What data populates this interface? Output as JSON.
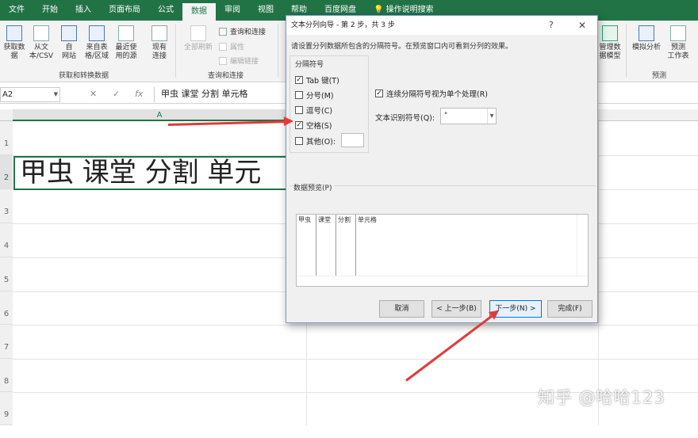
{
  "ribbon_tabs": [
    "文件",
    "开始",
    "插入",
    "页面布局",
    "公式",
    "数据",
    "审阅",
    "视图",
    "帮助",
    "百度网盘",
    "操作说明搜索"
  ],
  "ribbon": {
    "get_data": "获取数\n据",
    "from_text": "从文\n本/CSV",
    "from_web": "自\n网站",
    "from_table": "来自表\n格/区域",
    "recent_sources": "最近使\n用的源",
    "existing": "现有\n连接",
    "refresh_all": "全部刷新",
    "queries_connections": "查询和连接",
    "properties": "属性",
    "edit_links": "编辑链接",
    "manage_model": "管理数\n据模型",
    "what_if": "模拟分析",
    "forecast_sheet": "预测\n工作表",
    "group_get_transform": "获取和转换数据",
    "group_queries": "查询和连接",
    "group_forecast": "预测"
  },
  "formula_bar": {
    "name_box": "A2",
    "cancel": "✕",
    "enter": "✓",
    "fx": "fx",
    "content": "甲虫 课堂 分割 单元格"
  },
  "sheet": {
    "column_a": "A",
    "rows": [
      "1",
      "2",
      "3",
      "4",
      "5",
      "6",
      "7",
      "8",
      "9"
    ],
    "cell_a2": "甲虫 课堂 分割 单元"
  },
  "dialog": {
    "title": "文本分列向导 - 第 2 步，共 3 步",
    "help": "?",
    "close": "✕",
    "description": "请设置分列数据所包含的分隔符号。在预览窗口内可看到分列的效果。",
    "delimiters_label": "分隔符号",
    "delimiters": [
      {
        "label": "Tab 键(T)",
        "checked": true
      },
      {
        "label": "分号(M)",
        "checked": false
      },
      {
        "label": "逗号(C)",
        "checked": false
      },
      {
        "label": "空格(S)",
        "checked": true
      },
      {
        "label": "其他(O):",
        "checked": false
      }
    ],
    "consecutive_label": "连续分隔符号视为单个处理(R)",
    "consecutive_checked": true,
    "qualifier_label": "文本识别符号(Q):",
    "qualifier_value": "\"",
    "preview_label": "数据预览(P)",
    "preview_columns": [
      "甲虫",
      "课堂",
      "分割",
      "单元格"
    ],
    "buttons": {
      "cancel": "取消",
      "back": "< 上一步(B)",
      "next": "下一步(N) >",
      "finish": "完成(F)"
    }
  },
  "watermark": "知乎 @哈哈123",
  "colors": {
    "excel_green": "#217346",
    "arrow_red": "#e23a3a"
  }
}
